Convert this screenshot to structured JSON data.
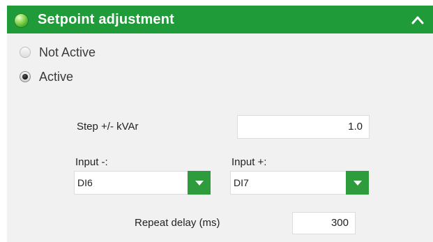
{
  "panel": {
    "title": "Setpoint adjustment",
    "colors": {
      "header": "#209b3a",
      "dropdown_button": "#2e9b3c",
      "background": "#f1f1f1"
    }
  },
  "mode": {
    "options": [
      {
        "label": "Not Active",
        "selected": false
      },
      {
        "label": "Active",
        "selected": true
      }
    ]
  },
  "step": {
    "label": "Step +/- kVAr",
    "value": "1.0"
  },
  "input_minus": {
    "label": "Input -:",
    "value": "DI6"
  },
  "input_plus": {
    "label": "Input +:",
    "value": "DI7"
  },
  "repeat_delay": {
    "label": "Repeat delay (ms)",
    "value": "300"
  },
  "icons": {
    "status": "green-led-icon",
    "collapse": "chevron-up-icon",
    "dropdown": "caret-down-icon"
  }
}
